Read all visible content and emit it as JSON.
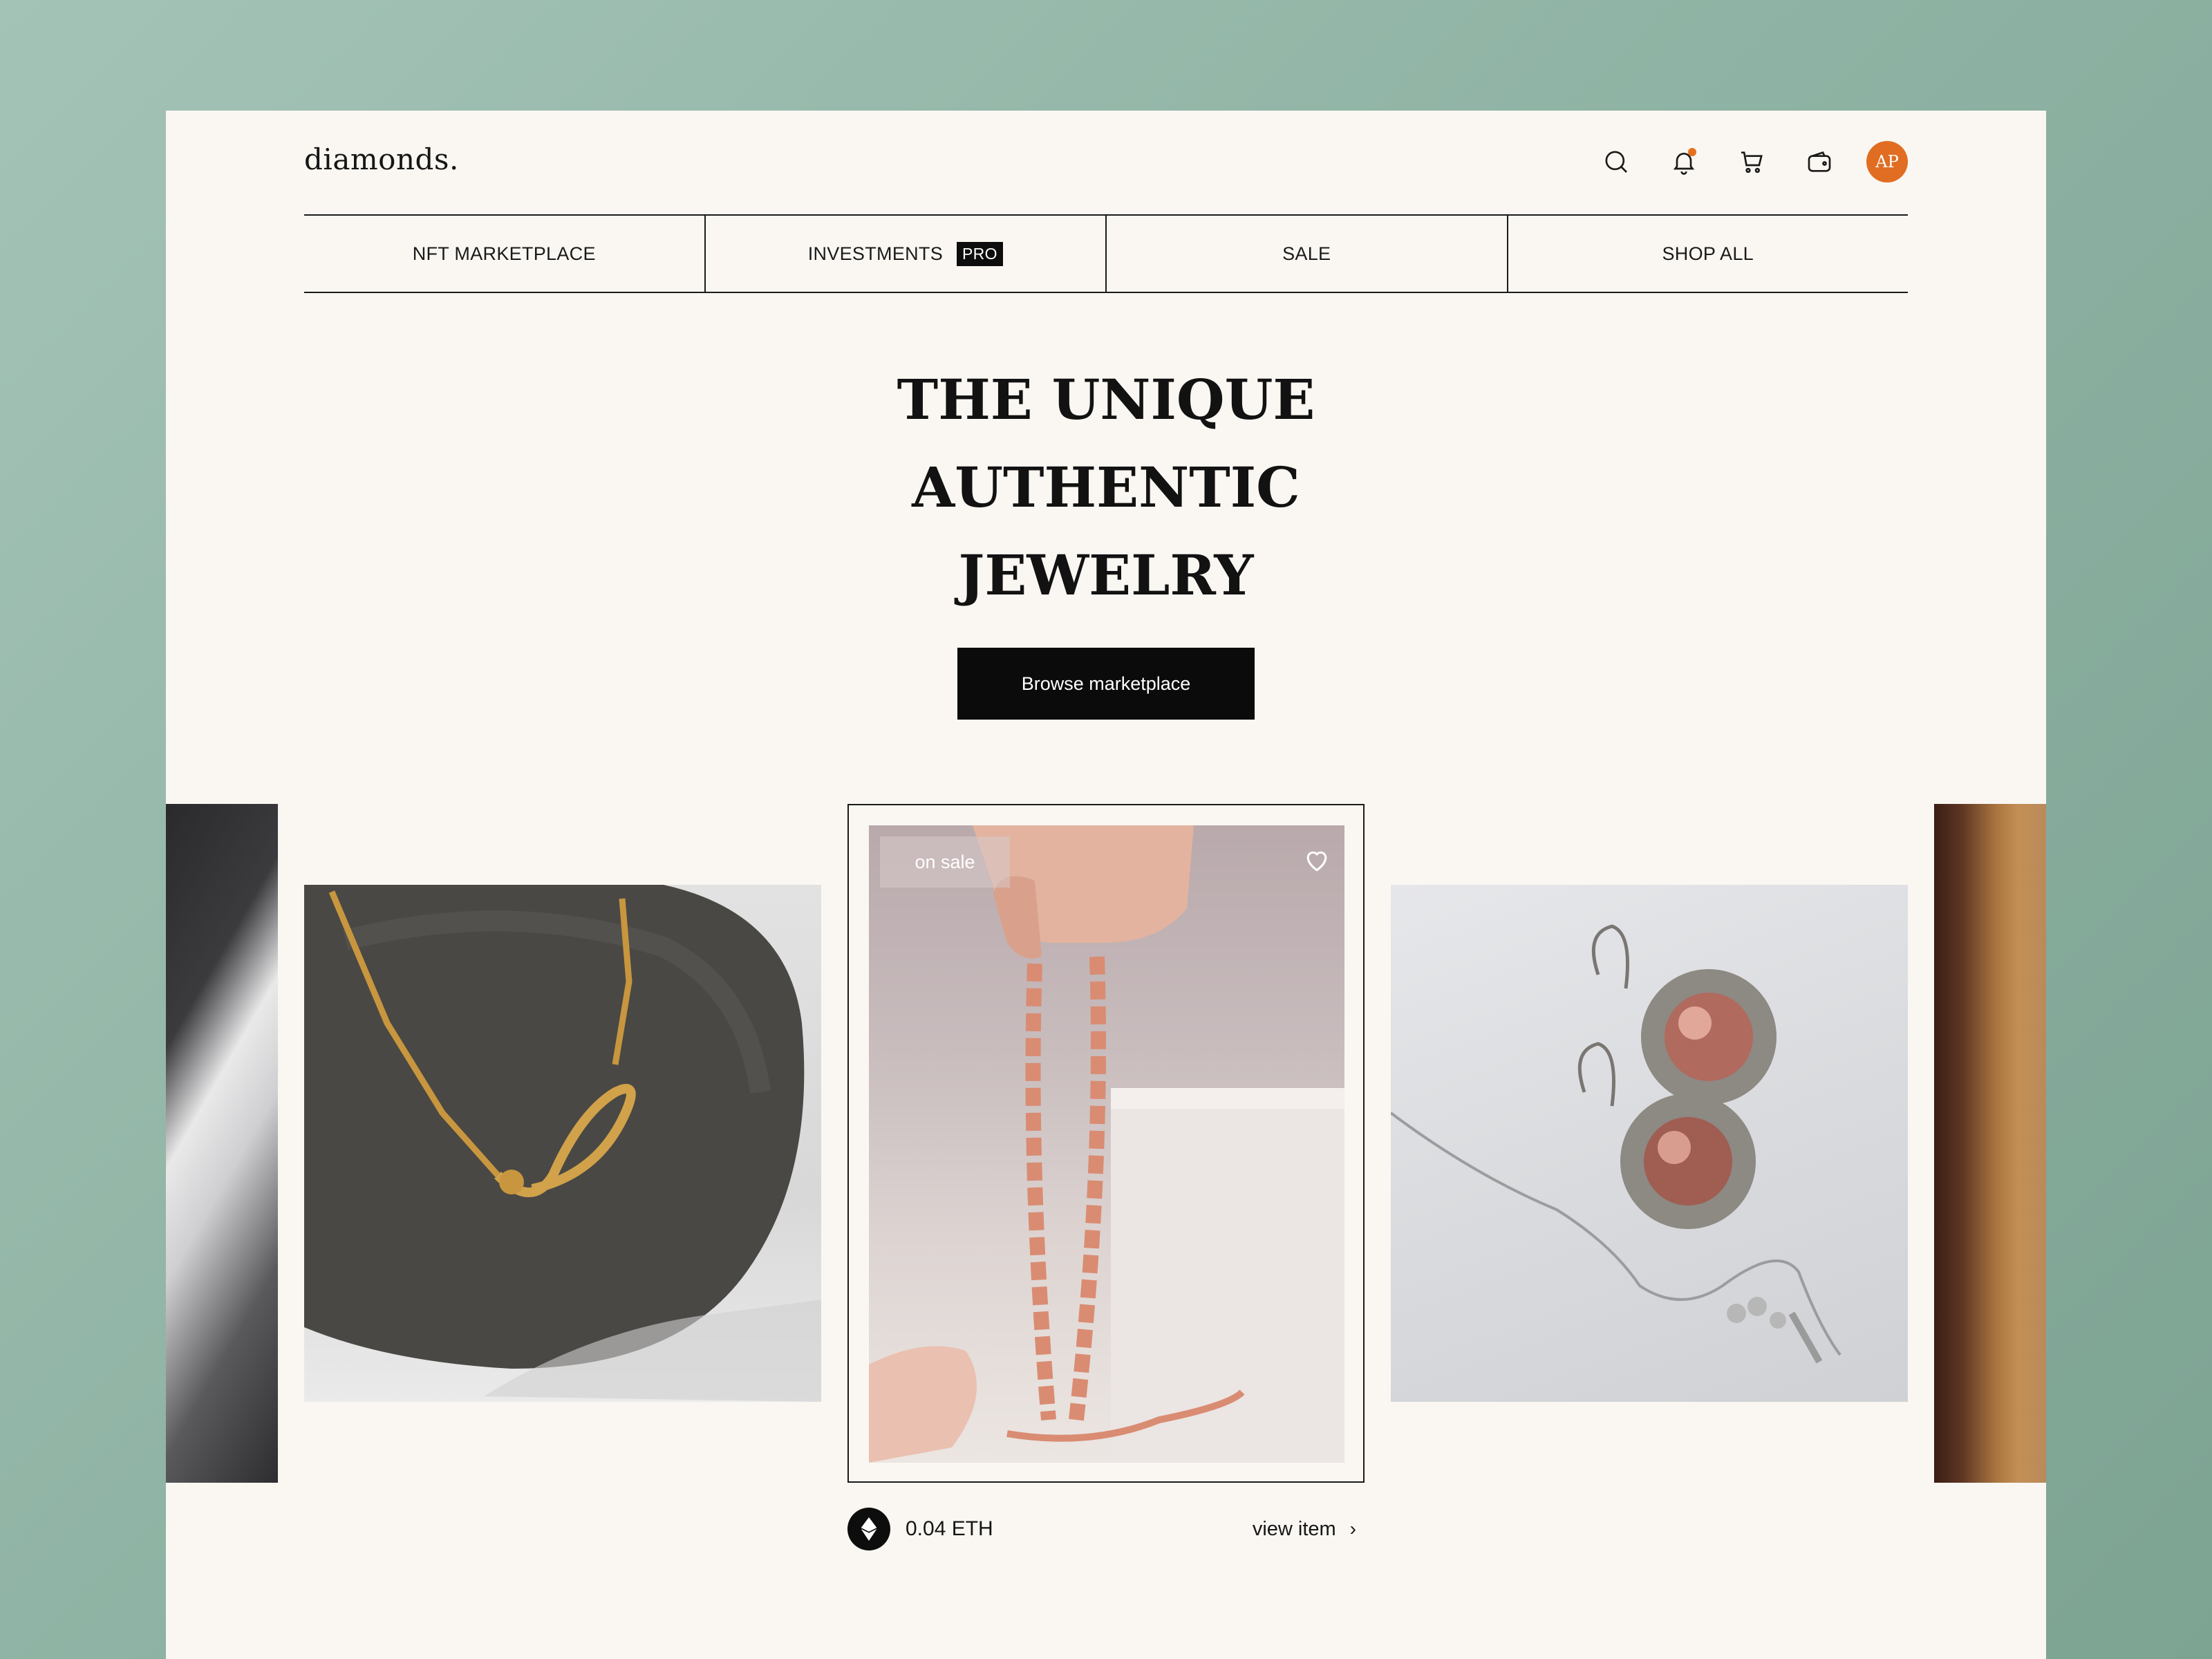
{
  "header": {
    "logo": "diamonds.",
    "icons": [
      "search-icon",
      "bell-icon",
      "cart-icon",
      "wallet-icon"
    ],
    "avatar_initials": "AP",
    "accent_color": "#e06d22"
  },
  "nav": {
    "items": [
      {
        "label": "NFT MARKETPLACE"
      },
      {
        "label": "INVESTMENTS",
        "badge": "PRO"
      },
      {
        "label": "SALE"
      },
      {
        "label": "SHOP ALL"
      }
    ]
  },
  "hero": {
    "title_lines": [
      "THE UNIQUE",
      "AUTHENTIC",
      "JEWELRY"
    ],
    "cta_label": "Browse marketplace"
  },
  "featured": {
    "tag": "on sale",
    "price": "0.04 ETH",
    "view_label": "view item",
    "view_chevron": "›"
  }
}
